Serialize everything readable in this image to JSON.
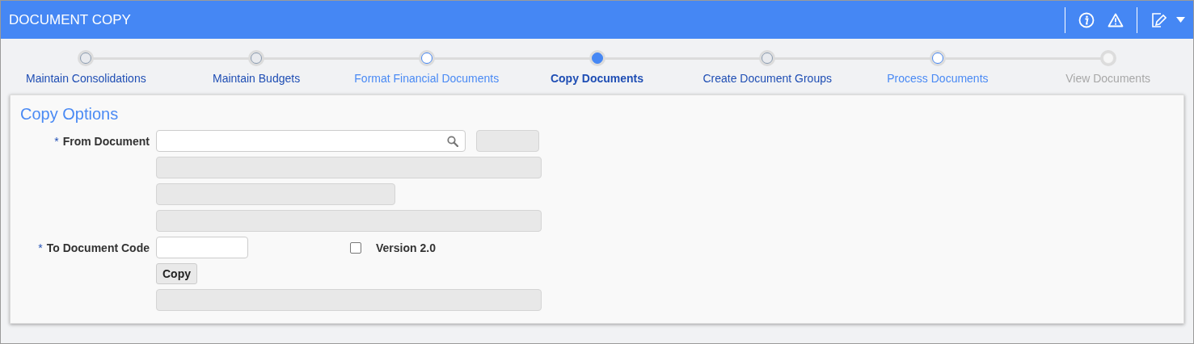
{
  "header": {
    "title": "DOCUMENT COPY"
  },
  "steps": [
    {
      "label": "Maintain Consolidations",
      "kind": "done"
    },
    {
      "label": "Maintain Budgets",
      "kind": "done"
    },
    {
      "label": "Format Financial Documents",
      "kind": "link"
    },
    {
      "label": "Copy Documents",
      "kind": "current"
    },
    {
      "label": "Create Document Groups",
      "kind": "done"
    },
    {
      "label": "Process Documents",
      "kind": "link"
    },
    {
      "label": "View Documents",
      "kind": "disabled"
    }
  ],
  "panel": {
    "title": "Copy Options",
    "from_document": {
      "label": "From Document",
      "required_mark": "*"
    },
    "to_document_code": {
      "label": "To Document Code",
      "required_mark": "*"
    },
    "version": {
      "label": "Version 2.0",
      "checked": false
    },
    "copy_button": "Copy"
  }
}
